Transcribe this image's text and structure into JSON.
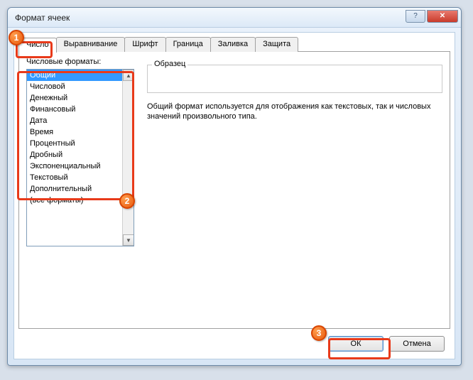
{
  "window": {
    "title": "Формат ячеек"
  },
  "tabs": [
    "Число",
    "Выравнивание",
    "Шрифт",
    "Граница",
    "Заливка",
    "Защита"
  ],
  "active_tab_index": 0,
  "formats_label": "Числовые форматы:",
  "formats": [
    "Общий",
    "Числовой",
    "Денежный",
    "Финансовый",
    "Дата",
    "Время",
    "Процентный",
    "Дробный",
    "Экспоненциальный",
    "Текстовый",
    "Дополнительный",
    "(все форматы)"
  ],
  "selected_format_index": 0,
  "sample_label": "Образец",
  "description": "Общий формат используется для отображения как текстовых, так и числовых значений произвольного типа.",
  "buttons": {
    "ok": "ОК",
    "cancel": "Отмена"
  },
  "annotations": {
    "m1": "1",
    "m2": "2",
    "m3": "3"
  }
}
